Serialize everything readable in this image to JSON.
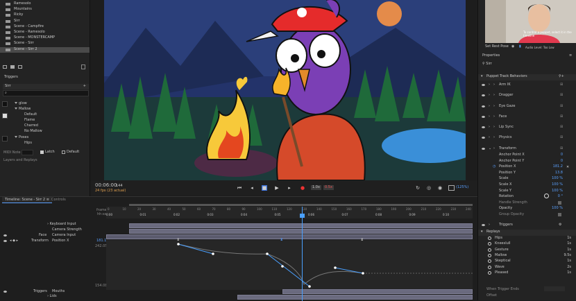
{
  "left_panel": {
    "scenes": [
      {
        "label": "Ramesolo",
        "selected": false
      },
      {
        "label": "Mountains",
        "selected": false
      },
      {
        "label": "Ricky",
        "selected": false
      },
      {
        "label": "Sirr",
        "selected": false
      },
      {
        "label": "Scene - Campfire",
        "selected": false
      },
      {
        "label": "Scene - Ramesolo",
        "selected": false
      },
      {
        "label": "Scene - MONSTERCAMP",
        "selected": false
      },
      {
        "label": "Scene - Sirr",
        "selected": false
      },
      {
        "label": "Scene - Sirr 2",
        "selected": true
      }
    ],
    "triggers_title": "Triggers",
    "puppet_name": "Sirr",
    "search_placeholder": "",
    "tree": [
      {
        "label": "glow",
        "indent": 1
      },
      {
        "label": "Mallow",
        "indent": 1
      },
      {
        "label": "Default",
        "indent": 3
      },
      {
        "label": "Flame",
        "indent": 3
      },
      {
        "label": "Charred",
        "indent": 3
      },
      {
        "label": "No Mallow",
        "indent": 3
      },
      {
        "label": "Poses",
        "indent": 1
      },
      {
        "label": "Hips",
        "indent": 3
      }
    ],
    "midi_note_label": "MIDI Note",
    "latch_label": "Latch",
    "default_label": "Default",
    "layers_label": "Layers and Replays"
  },
  "transport": {
    "timecode": "00:06:00",
    "frame": "144",
    "fps_info": "24 fps (23 actual)",
    "speed_a": "1.0x",
    "speed_b": "0.5x",
    "zoom": "(125%)"
  },
  "timeline": {
    "tab_label": "Timeline: Scene - Sirr 2",
    "controls_label": "Controls",
    "frames_label": "frames",
    "time_label": "hh:ss",
    "frame_ticks": [
      "0",
      "10",
      "20",
      "30",
      "40",
      "50",
      "60",
      "70",
      "80",
      "90",
      "100",
      "110",
      "120",
      "130",
      "140",
      "150",
      "160",
      "170",
      "180",
      "190",
      "200",
      "210",
      "220",
      "230",
      "240",
      "250"
    ],
    "time_ticks": [
      "0:00",
      "0:01",
      "0:02",
      "0:03",
      "0:04",
      "0:05",
      "0:06",
      "0:07",
      "0:08",
      "0:09",
      "0:10"
    ],
    "tracks": [
      {
        "label": "Keyboard Input"
      },
      {
        "label": "Camera Strength"
      },
      {
        "label": "Face",
        "sub": "Camera Input"
      },
      {
        "label": "Transform",
        "sub": "Position X",
        "value": "181.1"
      }
    ],
    "graph_values": {
      "top": "242.05",
      "bottom": "154.08"
    },
    "triggers_track": {
      "label": "Triggers",
      "sub": "Mouths"
    },
    "lids_label": "Lids"
  },
  "right_panel": {
    "webcam_text_a": "To control a puppet, select it in the timeline",
    "set_rest_pose": "Set Rest Pose",
    "audio_info": "Audio Level: Too Low",
    "properties_title": "Properties",
    "puppet_name": "Sirr",
    "behaviors_title": "Puppet Track Behaviors",
    "behaviors": [
      "Arm IK",
      "Dragger",
      "Eye Gaze",
      "Face",
      "Lip Sync",
      "Physics",
      "Transform"
    ],
    "transform_props": [
      {
        "name": "Anchor Point X",
        "value": "0"
      },
      {
        "name": "Anchor Point Y",
        "value": "0"
      },
      {
        "name": "Position X",
        "value": "181.2"
      },
      {
        "name": "Position Y",
        "value": "13.8"
      },
      {
        "name": "Scale",
        "value": "100 %"
      },
      {
        "name": "Scale X",
        "value": "100 %"
      },
      {
        "name": "Scale Y",
        "value": "100 %"
      },
      {
        "name": "Rotation",
        "value": "0 °"
      },
      {
        "name": "Handle Strength",
        "value": ""
      },
      {
        "name": "Opacity",
        "value": "100 %"
      },
      {
        "name": "Group Opacity",
        "value": ""
      }
    ],
    "triggers_title": "Triggers",
    "replays_title": "Replays",
    "replays": [
      {
        "name": "Hips",
        "value": "1s"
      },
      {
        "name": "Kneeslull",
        "value": "1s"
      },
      {
        "name": "Gesture",
        "value": "1s"
      },
      {
        "name": "Mallow",
        "value": "9.5s"
      },
      {
        "name": "Skeptical",
        "value": "1s"
      },
      {
        "name": "Wave",
        "value": "2s"
      },
      {
        "name": "Pleased",
        "value": "1s"
      }
    ],
    "footer_a": "When Trigger Ends",
    "footer_b": "Offset"
  }
}
